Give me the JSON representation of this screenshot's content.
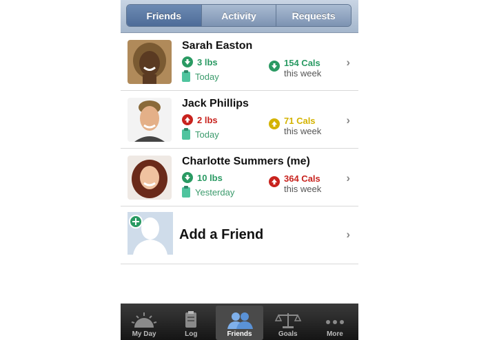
{
  "tabs_top": [
    {
      "label": "Friends"
    },
    {
      "label": "Activity"
    },
    {
      "label": "Requests"
    }
  ],
  "friends": [
    {
      "name": "Sarah Easton",
      "weight": "3 lbs",
      "weight_dir": "down",
      "weight_color": "#2a9a63",
      "day": "Today",
      "cals": "154 Cals",
      "cals_sub": "this week",
      "cals_dir": "down",
      "cals_color": "#2a9a63"
    },
    {
      "name": "Jack Phillips",
      "weight": "2 lbs",
      "weight_dir": "up",
      "weight_color": "#c8231e",
      "day": "Today",
      "cals": "71 Cals",
      "cals_sub": "this week",
      "cals_dir": "up",
      "cals_color": "#d4b300"
    },
    {
      "name": "Charlotte Summers (me)",
      "weight": "10 lbs",
      "weight_dir": "down",
      "weight_color": "#2a9a63",
      "day": "Yesterday",
      "cals": "364 Cals",
      "cals_sub": "this week",
      "cals_dir": "up",
      "cals_color": "#c8231e"
    }
  ],
  "add_friend": {
    "label": "Add a Friend"
  },
  "tabbar": [
    {
      "label": "My Day",
      "icon": "sun-icon"
    },
    {
      "label": "Log",
      "icon": "clipboard-icon"
    },
    {
      "label": "Friends",
      "icon": "people-icon"
    },
    {
      "label": "Goals",
      "icon": "scale-icon"
    },
    {
      "label": "More",
      "icon": "more-icon"
    }
  ],
  "colors": {
    "header": "#a4b6cc",
    "active_segment": "#4e6c98",
    "green": "#2a9a63",
    "red": "#c8231e",
    "yellow": "#d4b300"
  }
}
